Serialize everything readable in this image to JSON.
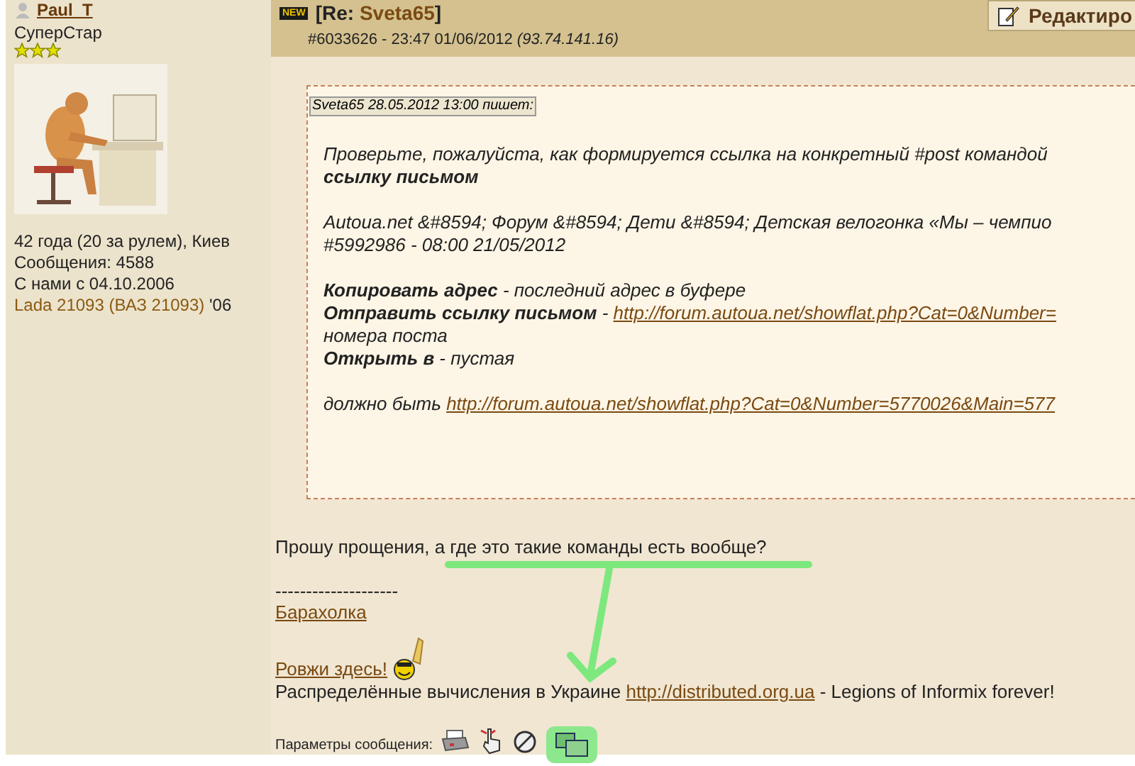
{
  "user": {
    "name": "Paul_T",
    "rank": "СуперСтар",
    "stars": 3,
    "info": [
      "42 года (20 за рулем), Киев",
      "Сообщения: 4588",
      "С нами с 04.10.2006"
    ],
    "car": {
      "model": "Lada 21093 (ВАЗ 21093)",
      "year": " '06"
    }
  },
  "post": {
    "badge": "NEW",
    "title_prefix": "[Re: ",
    "title_author": "Sveta65",
    "title_suffix": "]",
    "edit_button": "Редактиро",
    "meta": "#6033626 - 23:47 01/06/2012",
    "ip": "(93.74.141.16)"
  },
  "quote": {
    "header": "Sveta65 28.05.2012 13:00 пишет:",
    "blocks": [
      [
        [
          {
            "kind": "text",
            "text": "Проверьте, пожалуйста, как формируется ссылка на конкретный #post командой"
          }
        ],
        [
          {
            "kind": "bold",
            "text": "ссылку письмом"
          }
        ]
      ],
      [
        [
          {
            "kind": "text",
            "text": "Autoua.net &#8594; Форум &#8594; Дети &#8594; Детская велогонка «Мы – чемпио"
          }
        ],
        [
          {
            "kind": "text",
            "text": "#5992986 - 08:00 21/05/2012"
          }
        ]
      ],
      [
        [
          {
            "kind": "bold",
            "text": "Копировать адрес"
          },
          {
            "kind": "text",
            "text": " - последний адрес в буфере"
          }
        ],
        [
          {
            "kind": "bold",
            "text": "Отправить ссылку письмом"
          },
          {
            "kind": "text",
            "text": " - "
          },
          {
            "kind": "link",
            "text": "http://forum.autoua.net/showflat.php?Cat=0&Number="
          }
        ],
        [
          {
            "kind": "text",
            "text": "номера поста"
          }
        ],
        [
          {
            "kind": "bold",
            "text": "Открыть в"
          },
          {
            "kind": "text",
            "text": " - пустая"
          }
        ]
      ],
      [
        [
          {
            "kind": "text",
            "text": "должно быть "
          },
          {
            "kind": "link",
            "text": "http://forum.autoua.net/showflat.php?Cat=0&Number=5770026&Main=577"
          }
        ]
      ]
    ]
  },
  "body": "Прошу прощения, а где это такие команды есть вообще?",
  "signature": {
    "separator": "--------------------",
    "links": [
      "Барахолка",
      "Ровжи здесь!"
    ],
    "line": [
      {
        "kind": "text",
        "text": "Распределённые вычисления в Украине "
      },
      {
        "kind": "link",
        "text": "http://distributed.org.ua"
      },
      {
        "kind": "text",
        "text": " - Legions of Informix forever!"
      }
    ]
  },
  "footer": {
    "label": "Параметры сообщения:",
    "icons": [
      {
        "kind": "print",
        "highlighted": false
      },
      {
        "kind": "hand",
        "highlighted": false
      },
      {
        "kind": "block",
        "highlighted": false
      },
      {
        "kind": "copy",
        "highlighted": true
      }
    ]
  }
}
